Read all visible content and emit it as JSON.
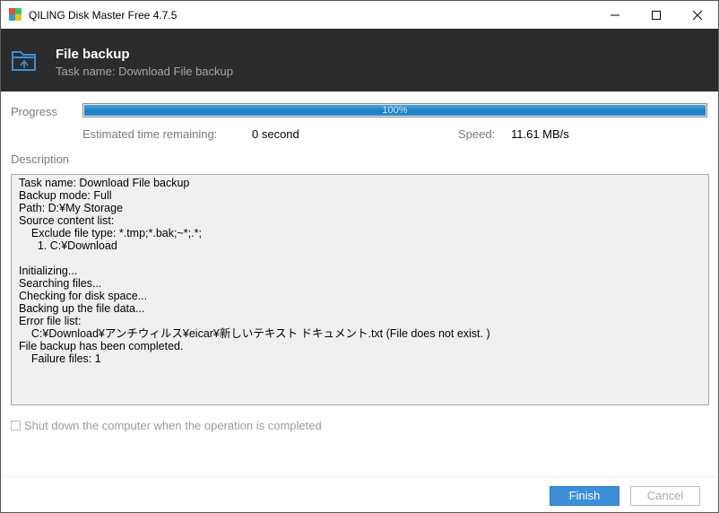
{
  "window": {
    "title": "QILING Disk Master Free 4.7.5"
  },
  "header": {
    "title": "File backup",
    "subtitle": "Task name: Download File backup"
  },
  "progress": {
    "label": "Progress",
    "percent_text": "100%",
    "fraction": 1.0,
    "estimated_label": "Estimated time remaining:",
    "estimated_value": "0 second",
    "speed_label": "Speed:",
    "speed_value": "11.61 MB/s"
  },
  "description": {
    "label": "Description",
    "lines": [
      "Task name: Download File backup",
      "Backup mode: Full",
      "Path: D:¥My Storage",
      "Source content list:",
      "    Exclude file type: *.tmp;*.bak;~*;.*;",
      "      1. C:¥Download",
      "",
      "Initializing...",
      "Searching files...",
      "Checking for disk space...",
      "Backing up the file data...",
      "Error file list:",
      "    C:¥Download¥アンチウィルス¥eicar¥新しいテキスト ドキュメント.txt (File does not exist. )",
      "File backup has been completed.",
      "    Failure files: 1"
    ]
  },
  "options": {
    "shutdown_label": "Shut down the computer when the operation is completed",
    "shutdown_checked": false
  },
  "buttons": {
    "finish": "Finish",
    "cancel": "Cancel"
  },
  "colors": {
    "header_bg": "#2b2b2b",
    "accent": "#3c8fd8",
    "progress": "#1a7fc1"
  }
}
